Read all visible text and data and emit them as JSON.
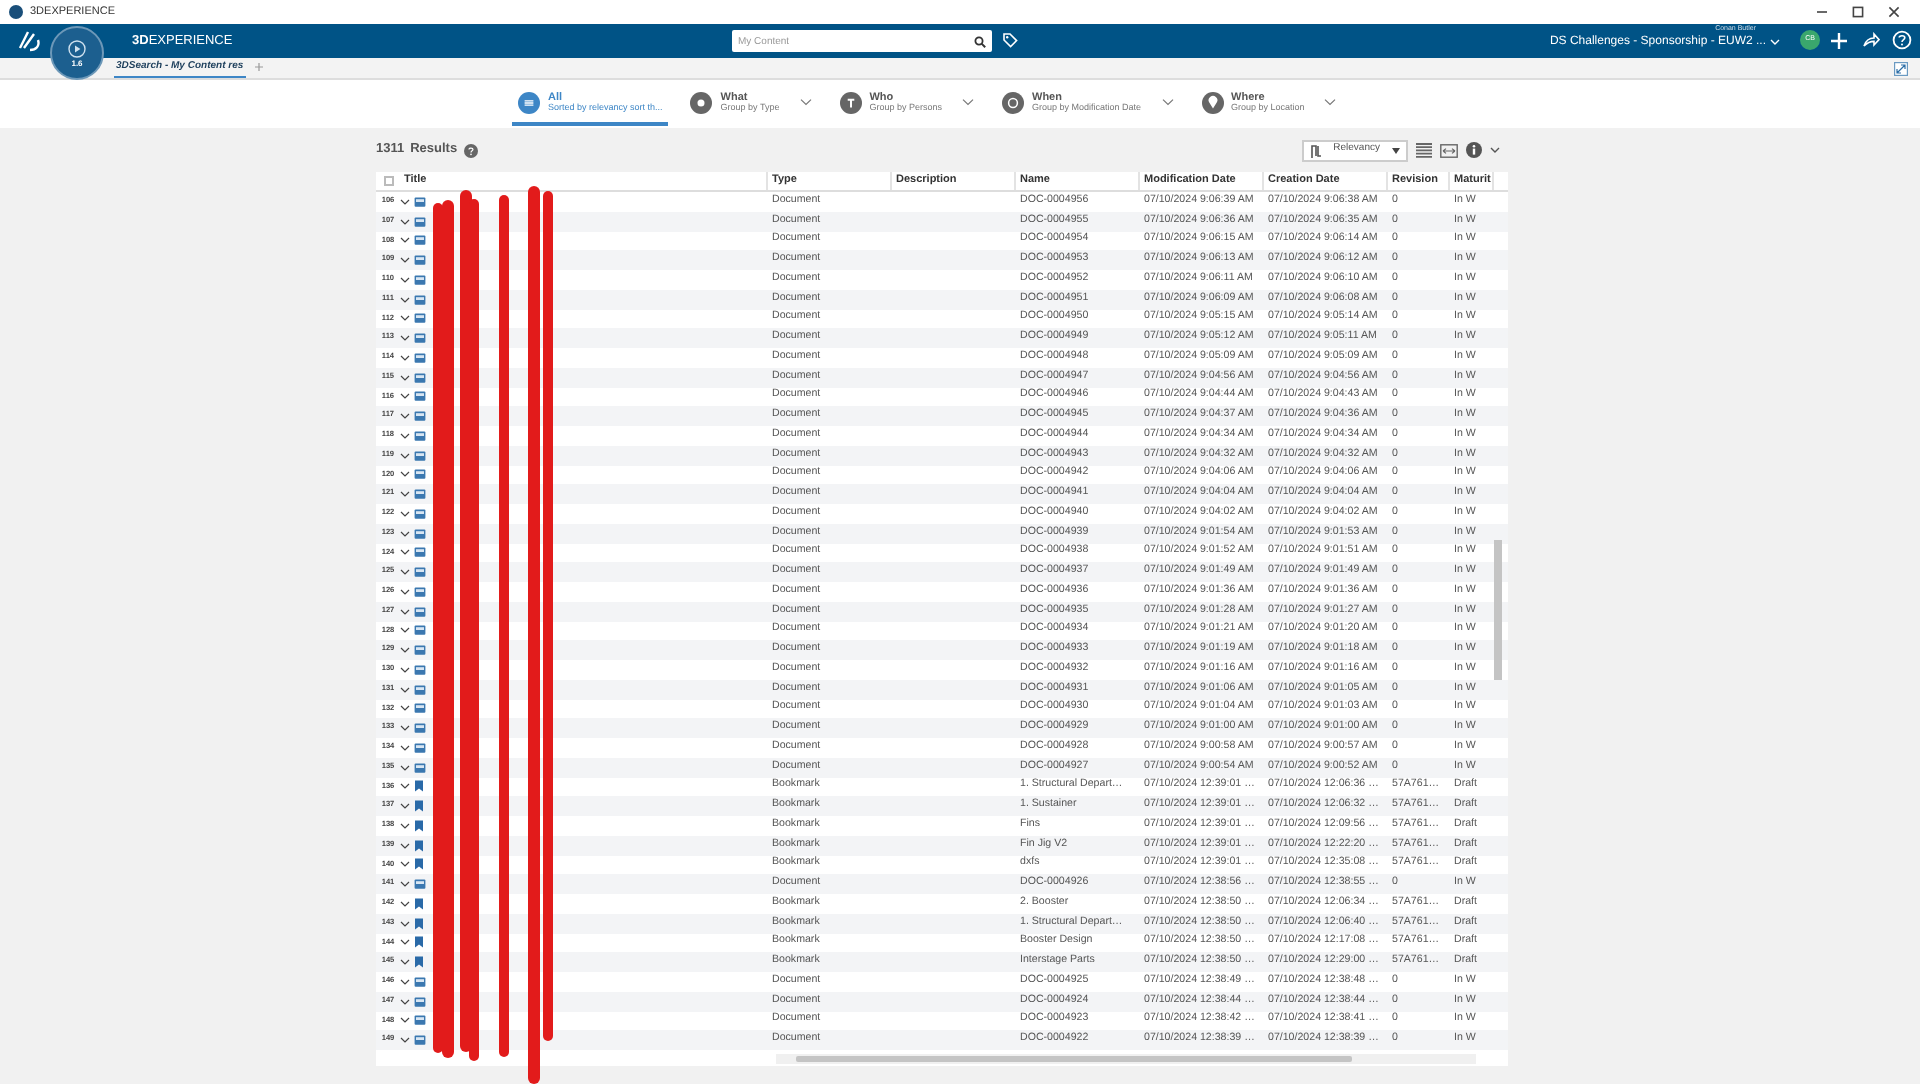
{
  "window": {
    "title": "3DEXPERIENCE"
  },
  "topbar": {
    "brand": "**3D**EXPERIENCE",
    "compass_label": "1.6",
    "search": {
      "placeholder": "My Content"
    },
    "user": "Conan Butler",
    "tenant": "DS Challenges - Sponsorship - EUW2 ...",
    "avatar": "CB"
  },
  "app_tabs": [
    {
      "label": "3DSearch - My Content res",
      "selected": true
    }
  ],
  "filters": [
    {
      "label": "All",
      "sub": "Sorted by relevancy sort th...",
      "kind": "all",
      "selected": true
    },
    {
      "label": "What",
      "sub": "Group by Type",
      "kind": "what",
      "selected": false
    },
    {
      "label": "Who",
      "sub": "Group by Persons",
      "kind": "who",
      "selected": false
    },
    {
      "label": "When",
      "sub": "Group by Modification Date",
      "kind": "when",
      "selected": false
    },
    {
      "label": "Where",
      "sub": "Group by Location",
      "kind": "where",
      "selected": false
    }
  ],
  "results": {
    "count": "1311",
    "label": "Results",
    "sort": "Relevancy"
  },
  "table": {
    "select_all": {
      "checked": false
    },
    "columns": [
      "Title",
      "Type",
      "Description",
      "Name",
      "Modification Date",
      "Creation Date",
      "Revision",
      "Maturit"
    ],
    "rows": [
      {
        "index": "106",
        "kind": "document",
        "type": "Document",
        "name": "DOC-0004956",
        "modified": "07/10/2024 9:06:39 AM",
        "created": "07/10/2024 9:06:38 AM",
        "revision": "0",
        "maturity": "In W"
      },
      {
        "index": "107",
        "kind": "document",
        "type": "Document",
        "name": "DOC-0004955",
        "modified": "07/10/2024 9:06:36 AM",
        "created": "07/10/2024 9:06:35 AM",
        "revision": "0",
        "maturity": "In W"
      },
      {
        "index": "108",
        "kind": "document",
        "type": "Document",
        "name": "DOC-0004954",
        "modified": "07/10/2024 9:06:15 AM",
        "created": "07/10/2024 9:06:14 AM",
        "revision": "0",
        "maturity": "In W"
      },
      {
        "index": "109",
        "kind": "document",
        "type": "Document",
        "name": "DOC-0004953",
        "modified": "07/10/2024 9:06:13 AM",
        "created": "07/10/2024 9:06:12 AM",
        "revision": "0",
        "maturity": "In W"
      },
      {
        "index": "110",
        "kind": "document",
        "type": "Document",
        "name": "DOC-0004952",
        "modified": "07/10/2024 9:06:11 AM",
        "created": "07/10/2024 9:06:10 AM",
        "revision": "0",
        "maturity": "In W"
      },
      {
        "index": "111",
        "kind": "document",
        "type": "Document",
        "name": "DOC-0004951",
        "modified": "07/10/2024 9:06:09 AM",
        "created": "07/10/2024 9:06:08 AM",
        "revision": "0",
        "maturity": "In W"
      },
      {
        "index": "112",
        "kind": "document",
        "type": "Document",
        "name": "DOC-0004950",
        "modified": "07/10/2024 9:05:15 AM",
        "created": "07/10/2024 9:05:14 AM",
        "revision": "0",
        "maturity": "In W"
      },
      {
        "index": "113",
        "kind": "document",
        "type": "Document",
        "name": "DOC-0004949",
        "modified": "07/10/2024 9:05:12 AM",
        "created": "07/10/2024 9:05:11 AM",
        "revision": "0",
        "maturity": "In W"
      },
      {
        "index": "114",
        "kind": "document",
        "type": "Document",
        "name": "DOC-0004948",
        "modified": "07/10/2024 9:05:09 AM",
        "created": "07/10/2024 9:05:09 AM",
        "revision": "0",
        "maturity": "In W"
      },
      {
        "index": "115",
        "kind": "document",
        "type": "Document",
        "name": "DOC-0004947",
        "modified": "07/10/2024 9:04:56 AM",
        "created": "07/10/2024 9:04:56 AM",
        "revision": "0",
        "maturity": "In W"
      },
      {
        "index": "116",
        "kind": "document",
        "type": "Document",
        "name": "DOC-0004946",
        "modified": "07/10/2024 9:04:44 AM",
        "created": "07/10/2024 9:04:43 AM",
        "revision": "0",
        "maturity": "In W"
      },
      {
        "index": "117",
        "kind": "document",
        "type": "Document",
        "name": "DOC-0004945",
        "modified": "07/10/2024 9:04:37 AM",
        "created": "07/10/2024 9:04:36 AM",
        "revision": "0",
        "maturity": "In W"
      },
      {
        "index": "118",
        "kind": "document",
        "type": "Document",
        "name": "DOC-0004944",
        "modified": "07/10/2024 9:04:34 AM",
        "created": "07/10/2024 9:04:34 AM",
        "revision": "0",
        "maturity": "In W"
      },
      {
        "index": "119",
        "kind": "document",
        "type": "Document",
        "name": "DOC-0004943",
        "modified": "07/10/2024 9:04:32 AM",
        "created": "07/10/2024 9:04:32 AM",
        "revision": "0",
        "maturity": "In W"
      },
      {
        "index": "120",
        "kind": "document",
        "type": "Document",
        "name": "DOC-0004942",
        "modified": "07/10/2024 9:04:06 AM",
        "created": "07/10/2024 9:04:06 AM",
        "revision": "0",
        "maturity": "In W"
      },
      {
        "index": "121",
        "kind": "document",
        "type": "Document",
        "name": "DOC-0004941",
        "modified": "07/10/2024 9:04:04 AM",
        "created": "07/10/2024 9:04:04 AM",
        "revision": "0",
        "maturity": "In W"
      },
      {
        "index": "122",
        "kind": "document",
        "type": "Document",
        "name": "DOC-0004940",
        "modified": "07/10/2024 9:04:02 AM",
        "created": "07/10/2024 9:04:02 AM",
        "revision": "0",
        "maturity": "In W"
      },
      {
        "index": "123",
        "kind": "document",
        "type": "Document",
        "name": "DOC-0004939",
        "modified": "07/10/2024 9:01:54 AM",
        "created": "07/10/2024 9:01:53 AM",
        "revision": "0",
        "maturity": "In W"
      },
      {
        "index": "124",
        "kind": "document",
        "type": "Document",
        "name": "DOC-0004938",
        "modified": "07/10/2024 9:01:52 AM",
        "created": "07/10/2024 9:01:51 AM",
        "revision": "0",
        "maturity": "In W"
      },
      {
        "index": "125",
        "kind": "document",
        "type": "Document",
        "name": "DOC-0004937",
        "modified": "07/10/2024 9:01:49 AM",
        "created": "07/10/2024 9:01:49 AM",
        "revision": "0",
        "maturity": "In W"
      },
      {
        "index": "126",
        "kind": "document",
        "type": "Document",
        "name": "DOC-0004936",
        "modified": "07/10/2024 9:01:36 AM",
        "created": "07/10/2024 9:01:36 AM",
        "revision": "0",
        "maturity": "In W"
      },
      {
        "index": "127",
        "kind": "document",
        "type": "Document",
        "name": "DOC-0004935",
        "modified": "07/10/2024 9:01:28 AM",
        "created": "07/10/2024 9:01:27 AM",
        "revision": "0",
        "maturity": "In W"
      },
      {
        "index": "128",
        "kind": "document",
        "type": "Document",
        "name": "DOC-0004934",
        "modified": "07/10/2024 9:01:21 AM",
        "created": "07/10/2024 9:01:20 AM",
        "revision": "0",
        "maturity": "In W"
      },
      {
        "index": "129",
        "kind": "document",
        "type": "Document",
        "name": "DOC-0004933",
        "modified": "07/10/2024 9:01:19 AM",
        "created": "07/10/2024 9:01:18 AM",
        "revision": "0",
        "maturity": "In W"
      },
      {
        "index": "130",
        "kind": "document",
        "type": "Document",
        "name": "DOC-0004932",
        "modified": "07/10/2024 9:01:16 AM",
        "created": "07/10/2024 9:01:16 AM",
        "revision": "0",
        "maturity": "In W"
      },
      {
        "index": "131",
        "kind": "document",
        "type": "Document",
        "name": "DOC-0004931",
        "modified": "07/10/2024 9:01:06 AM",
        "created": "07/10/2024 9:01:05 AM",
        "revision": "0",
        "maturity": "In W"
      },
      {
        "index": "132",
        "kind": "document",
        "type": "Document",
        "name": "DOC-0004930",
        "modified": "07/10/2024 9:01:04 AM",
        "created": "07/10/2024 9:01:03 AM",
        "revision": "0",
        "maturity": "In W"
      },
      {
        "index": "133",
        "kind": "document",
        "type": "Document",
        "name": "DOC-0004929",
        "modified": "07/10/2024 9:01:00 AM",
        "created": "07/10/2024 9:01:00 AM",
        "revision": "0",
        "maturity": "In W"
      },
      {
        "index": "134",
        "kind": "document",
        "type": "Document",
        "name": "DOC-0004928",
        "modified": "07/10/2024 9:00:58 AM",
        "created": "07/10/2024 9:00:57 AM",
        "revision": "0",
        "maturity": "In W"
      },
      {
        "index": "135",
        "kind": "document",
        "type": "Document",
        "name": "DOC-0004927",
        "modified": "07/10/2024 9:00:54 AM",
        "created": "07/10/2024 9:00:52 AM",
        "revision": "0",
        "maturity": "In W"
      },
      {
        "index": "136",
        "kind": "bookmark",
        "type": "Bookmark",
        "name": "1. Structural Depart…",
        "modified": "07/10/2024 12:39:01 …",
        "created": "07/10/2024 12:06:36 …",
        "revision": "57A761…",
        "maturity": "Draft"
      },
      {
        "index": "137",
        "kind": "bookmark",
        "type": "Bookmark",
        "name": "1. Sustainer",
        "modified": "07/10/2024 12:39:01 …",
        "created": "07/10/2024 12:06:32 …",
        "revision": "57A761…",
        "maturity": "Draft"
      },
      {
        "index": "138",
        "kind": "bookmark",
        "type": "Bookmark",
        "name": "Fins",
        "modified": "07/10/2024 12:39:01 …",
        "created": "07/10/2024 12:09:56 …",
        "revision": "57A761…",
        "maturity": "Draft"
      },
      {
        "index": "139",
        "kind": "bookmark",
        "type": "Bookmark",
        "name": "Fin Jig V2",
        "modified": "07/10/2024 12:39:01 …",
        "created": "07/10/2024 12:22:20 …",
        "revision": "57A761…",
        "maturity": "Draft"
      },
      {
        "index": "140",
        "kind": "bookmark",
        "type": "Bookmark",
        "name": "dxfs",
        "modified": "07/10/2024 12:39:01 …",
        "created": "07/10/2024 12:35:08 …",
        "revision": "57A761…",
        "maturity": "Draft"
      },
      {
        "index": "141",
        "kind": "document",
        "type": "Document",
        "name": "DOC-0004926",
        "modified": "07/10/2024 12:38:56 …",
        "created": "07/10/2024 12:38:55 …",
        "revision": "0",
        "maturity": "In W"
      },
      {
        "index": "142",
        "kind": "bookmark",
        "type": "Bookmark",
        "name": "2. Booster",
        "modified": "07/10/2024 12:38:50 …",
        "created": "07/10/2024 12:06:34 …",
        "revision": "57A761…",
        "maturity": "Draft"
      },
      {
        "index": "143",
        "kind": "bookmark",
        "type": "Bookmark",
        "name": "1. Structural Depart…",
        "modified": "07/10/2024 12:38:50 …",
        "created": "07/10/2024 12:06:40 …",
        "revision": "57A761…",
        "maturity": "Draft"
      },
      {
        "index": "144",
        "kind": "bookmark",
        "type": "Bookmark",
        "name": "Booster Design",
        "modified": "07/10/2024 12:38:50 …",
        "created": "07/10/2024 12:17:08 …",
        "revision": "57A761…",
        "maturity": "Draft"
      },
      {
        "index": "145",
        "kind": "bookmark",
        "type": "Bookmark",
        "name": "Interstage Parts",
        "modified": "07/10/2024 12:38:50 …",
        "created": "07/10/2024 12:29:00 …",
        "revision": "57A761…",
        "maturity": "Draft"
      },
      {
        "index": "146",
        "kind": "document",
        "type": "Document",
        "name": "DOC-0004925",
        "modified": "07/10/2024 12:38:49 …",
        "created": "07/10/2024 12:38:48 …",
        "revision": "0",
        "maturity": "In W"
      },
      {
        "index": "147",
        "kind": "document",
        "type": "Document",
        "name": "DOC-0004924",
        "modified": "07/10/2024 12:38:44 …",
        "created": "07/10/2024 12:38:44 …",
        "revision": "0",
        "maturity": "In W"
      },
      {
        "index": "148",
        "kind": "document",
        "type": "Document",
        "name": "DOC-0004923",
        "modified": "07/10/2024 12:38:42 …",
        "created": "07/10/2024 12:38:41 …",
        "revision": "0",
        "maturity": "In W"
      },
      {
        "index": "149",
        "kind": "document",
        "type": "Document",
        "name": "DOC-0004922",
        "modified": "07/10/2024 12:38:39 …",
        "created": "07/10/2024 12:38:39 …",
        "revision": "0",
        "maturity": "In W"
      }
    ]
  }
}
